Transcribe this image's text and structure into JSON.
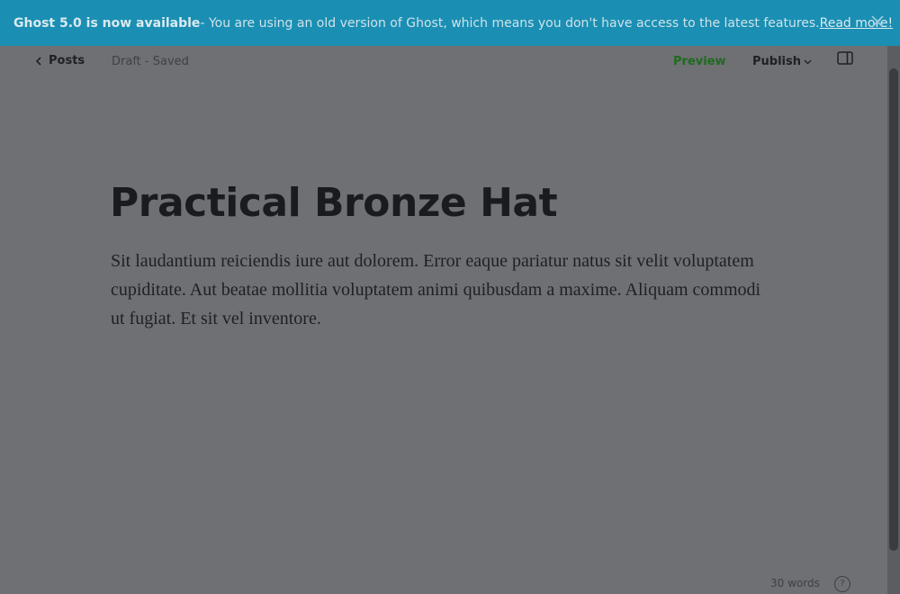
{
  "banner": {
    "headline": "Ghost 5.0 is now available",
    "message": " - You are using an old version of Ghost, which means you don't have access to the latest features. ",
    "link_label": "Read more!",
    "close_icon": "close-icon"
  },
  "header": {
    "back_label": "Posts",
    "back_icon": "chevron-left-icon",
    "status": "Draft - Saved",
    "preview_label": "Preview",
    "publish_label": "Publish",
    "publish_icon": "chevron-down-icon",
    "sidebar_icon": "sidebar-toggle-icon"
  },
  "post": {
    "title": "Practical Bronze Hat",
    "body": "Sit laudantium reiciendis iure aut dolorem. Error eaque pariatur natus sit velit voluptatem cupiditate. Aut beatae mollitia voluptatem animi quibusdam a maxime. Aliquam commodi ut fugiat. Et sit vel inventore."
  },
  "footer": {
    "word_count": "30 words",
    "help_label": "?"
  },
  "colors": {
    "banner_bg": "#1a8fb3",
    "overlay_bg": "#6e7073",
    "preview_green": "#1e6b1e"
  }
}
